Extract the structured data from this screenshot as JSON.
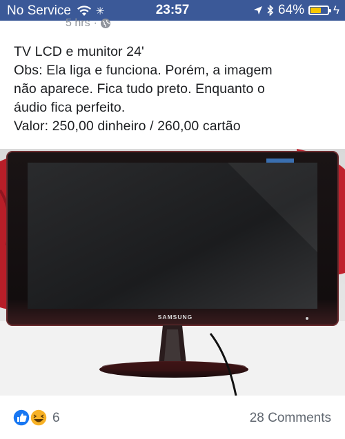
{
  "status_bar": {
    "carrier": "No Service",
    "time": "23:57",
    "battery_percent": "64%",
    "battery_level": 0.64,
    "background_color": "#3b5998",
    "battery_color": "#f7c600",
    "icons": [
      "wifi-icon",
      "activity-spinner-icon",
      "location-arrow-icon",
      "bluetooth-icon",
      "battery-icon",
      "charging-bolt-icon"
    ]
  },
  "post": {
    "timestamp": "5 hrs",
    "separator": "·",
    "privacy_icon": "globe-icon",
    "lines": [
      "TV LCD e munitor 24'",
      "Obs: Ela liga e funciona. Porém, a imagem",
      "não aparece. Fica tudo preto. Enquanto o",
      "áudio fica perfeito.",
      "Valor: 250,00 dinheiro /  260,00 cartão"
    ],
    "photo": {
      "brand_logo": "SAMSUNG"
    }
  },
  "footer": {
    "reaction_icons": [
      "like-reaction-icon",
      "haha-reaction-icon"
    ],
    "reaction_count": "6",
    "comments": "28 Comments",
    "like_color": "#1877f2",
    "haha_color": "#f7b125"
  }
}
